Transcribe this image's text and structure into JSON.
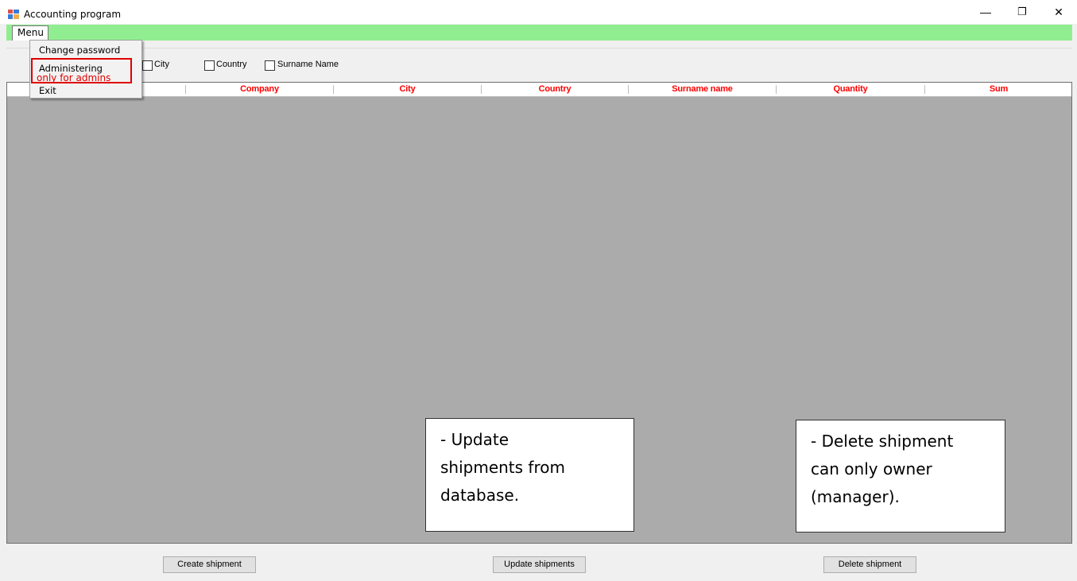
{
  "window": {
    "title": "Accounting program",
    "minimize": "—",
    "restore": "❐",
    "close": "✕"
  },
  "menu": {
    "label": "Menu",
    "items": [
      {
        "label": "Change password"
      },
      {
        "label": "Administering",
        "note": "only for admins"
      },
      {
        "label": "Exit"
      }
    ]
  },
  "filters": [
    {
      "label": "City",
      "checked": false
    },
    {
      "label": "Country",
      "checked": false
    },
    {
      "label": "Surname Name",
      "checked": false
    }
  ],
  "grid": {
    "columns": [
      "Company",
      "City",
      "Country",
      "Surname name",
      "Quantity",
      "Sum"
    ],
    "header_color": "#ff0000",
    "background": "#ababab"
  },
  "notes": {
    "update": [
      "- Update",
      "shipments from",
      "database."
    ],
    "delete": [
      "- Delete shipment",
      "can only owner",
      "(manager)."
    ]
  },
  "buttons": {
    "create": "Create shipment",
    "update": "Update shipments",
    "delete": "Delete shipment"
  },
  "colors": {
    "menubar": "#90ee90",
    "highlight": "#e00000"
  }
}
